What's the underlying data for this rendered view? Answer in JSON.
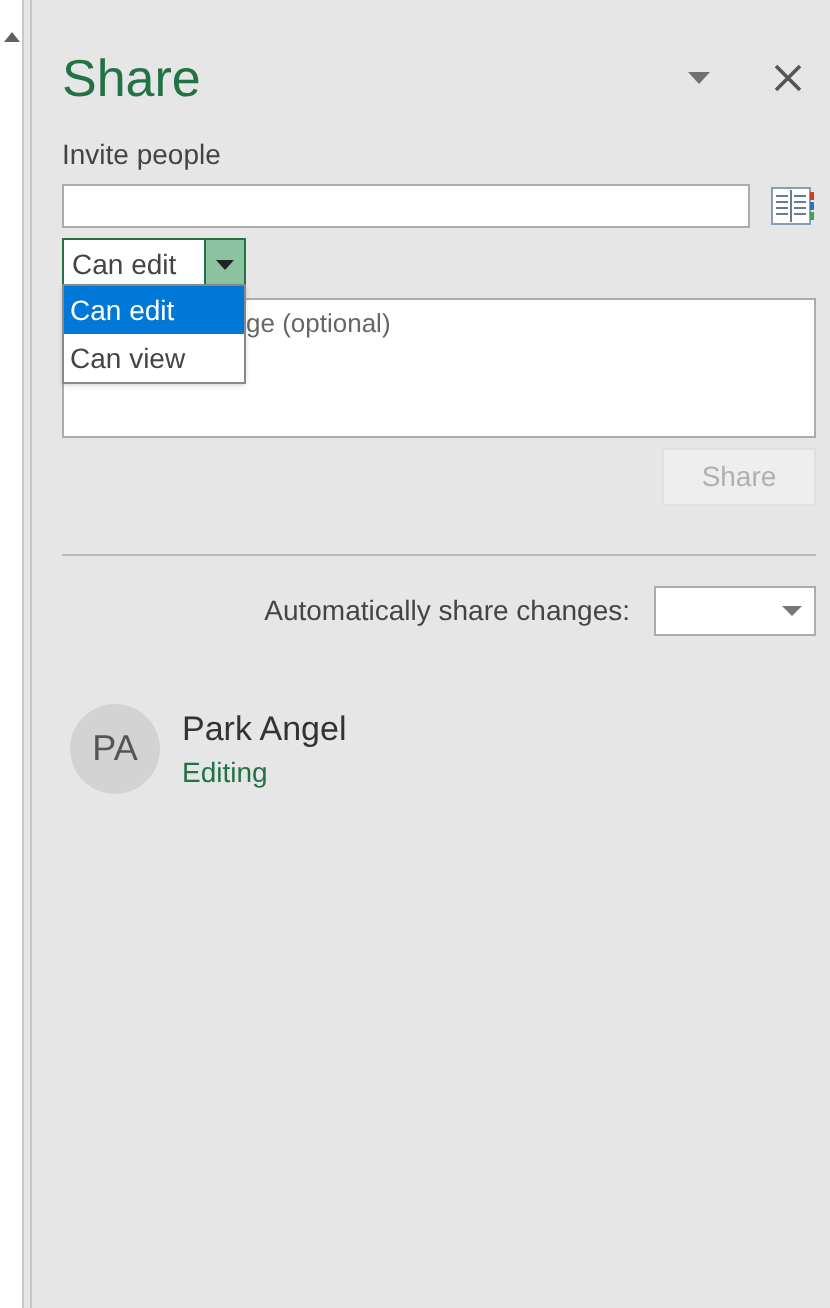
{
  "panel": {
    "title": "Share"
  },
  "invite": {
    "label": "Invite people"
  },
  "permission": {
    "value": "Can edit",
    "expanded": true,
    "options": [
      {
        "label": "Can edit",
        "selected": true
      },
      {
        "label": "Can view",
        "selected": false
      }
    ]
  },
  "message": {
    "placeholder": "ge (optional)"
  },
  "share_button": {
    "label": "Share",
    "disabled": true
  },
  "auto_share": {
    "label": "Automatically share changes:"
  },
  "people": [
    {
      "initials": "PA",
      "name": "Park Angel",
      "status": "Editing"
    }
  ]
}
